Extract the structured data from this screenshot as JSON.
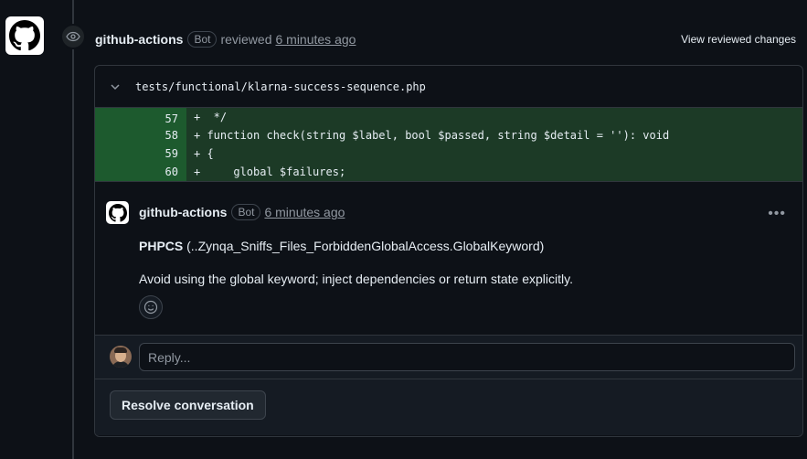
{
  "review": {
    "author": "github-actions",
    "bot_badge": "Bot",
    "action": "reviewed",
    "time": "6 minutes ago",
    "view_changes": "View reviewed changes"
  },
  "file": {
    "path": "tests/functional/klarna-success-sequence.php"
  },
  "diff_lines": [
    {
      "num": "57",
      "code": "+  */"
    },
    {
      "num": "58",
      "code": "+ function check(string $label, bool $passed, string $detail = ''): void"
    },
    {
      "num": "59",
      "code": "+ {"
    },
    {
      "num": "60",
      "code": "+     global $failures;"
    }
  ],
  "comment": {
    "author": "github-actions",
    "bot_badge": "Bot",
    "time": "6 minutes ago",
    "tool": "PHPCS",
    "rule": " (..Zynqa_Sniffs_Files_ForbiddenGlobalAccess.GlobalKeyword)",
    "message": "Avoid using the global keyword; inject dependencies or return state explicitly."
  },
  "reply": {
    "placeholder": "Reply..."
  },
  "resolve": {
    "label": "Resolve conversation"
  },
  "icons": {
    "main_avatar": "github-logo-icon",
    "review_badge": "eye-icon",
    "file_toggle": "chevron-down-icon",
    "more": "kebab-horizontal-icon",
    "reaction": "smiley-icon"
  },
  "colors": {
    "background": "#0d1117",
    "diff_add": "#1c3a26",
    "diff_add_gutter": "#1d5a2e",
    "border": "#30363d",
    "muted_text": "#9198a1"
  }
}
